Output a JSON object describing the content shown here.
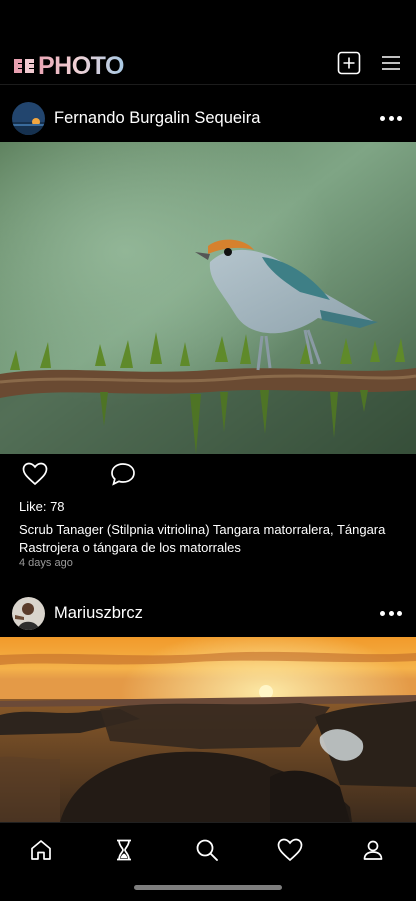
{
  "app": {
    "logo_text": "PHOTO"
  },
  "header": {
    "icons": [
      "add-post-icon",
      "menu-icon"
    ]
  },
  "posts": [
    {
      "username": "Fernando Burgalin Sequeira",
      "likes_text": "Like: 78",
      "caption": "Scrub Tanager (Stilpnia vitriolina) Tangara matorralera, Tángara Rastrojera o tángara de los matorrales",
      "time": "4 days ago"
    },
    {
      "username": "Mariuszbrcz"
    }
  ],
  "tabbar": {
    "tabs": [
      "home-icon",
      "hourglass-icon",
      "search-icon",
      "heart-icon",
      "profile-icon"
    ]
  },
  "colors": {
    "background": "#000000",
    "text": "#ffffff",
    "muted": "#9a9a9a"
  }
}
